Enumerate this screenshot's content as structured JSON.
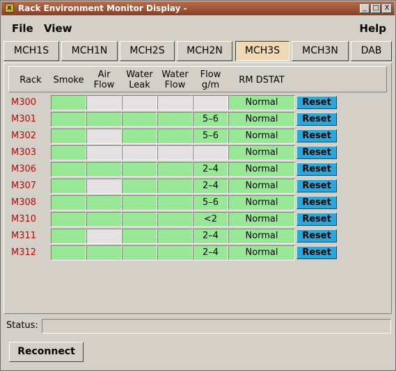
{
  "window": {
    "title": "Rack Environment Monitor Display -",
    "controls": [
      "_",
      "□",
      "X"
    ]
  },
  "menu": {
    "file": "File",
    "view": "View",
    "help": "Help"
  },
  "tabs": [
    "MCH1S",
    "MCH1N",
    "MCH2S",
    "MCH2N",
    "MCH3S",
    "MCH3N",
    "DAB"
  ],
  "active_tab": "MCH3S",
  "columns": {
    "rack": "Rack",
    "smoke": "Smoke",
    "air_flow": [
      "Air",
      "Flow"
    ],
    "water_leak": [
      "Water",
      "Leak"
    ],
    "water_flow": [
      "Water",
      "Flow"
    ],
    "flow_gm": [
      "Flow",
      "g/m"
    ],
    "rm_dstat": "RM DSTAT"
  },
  "colors": {
    "ok": "#98e898",
    "inactive": "#e6e2e4",
    "rack_label": "#d00000",
    "reset": "#29a8d9"
  },
  "rows": [
    {
      "rack": "M300",
      "smoke": "ok",
      "air_flow": "inactive",
      "water_leak": "inactive",
      "water_flow": "inactive",
      "flow_state": "inactive",
      "flow": "",
      "dstat": "Normal",
      "reset": "Reset"
    },
    {
      "rack": "M301",
      "smoke": "ok",
      "air_flow": "ok",
      "water_leak": "ok",
      "water_flow": "ok",
      "flow_state": "ok",
      "flow": "5–6",
      "dstat": "Normal",
      "reset": "Reset"
    },
    {
      "rack": "M302",
      "smoke": "ok",
      "air_flow": "inactive",
      "water_leak": "ok",
      "water_flow": "ok",
      "flow_state": "ok",
      "flow": "5–6",
      "dstat": "Normal",
      "reset": "Reset"
    },
    {
      "rack": "M303",
      "smoke": "ok",
      "air_flow": "inactive",
      "water_leak": "inactive",
      "water_flow": "inactive",
      "flow_state": "inactive",
      "flow": "",
      "dstat": "Normal",
      "reset": "Reset"
    },
    {
      "rack": "M306",
      "smoke": "ok",
      "air_flow": "ok",
      "water_leak": "ok",
      "water_flow": "ok",
      "flow_state": "ok",
      "flow": "2–4",
      "dstat": "Normal",
      "reset": "Reset"
    },
    {
      "rack": "M307",
      "smoke": "ok",
      "air_flow": "inactive",
      "water_leak": "ok",
      "water_flow": "ok",
      "flow_state": "ok",
      "flow": "2–4",
      "dstat": "Normal",
      "reset": "Reset"
    },
    {
      "rack": "M308",
      "smoke": "ok",
      "air_flow": "ok",
      "water_leak": "ok",
      "water_flow": "ok",
      "flow_state": "ok",
      "flow": "5–6",
      "dstat": "Normal",
      "reset": "Reset"
    },
    {
      "rack": "M310",
      "smoke": "ok",
      "air_flow": "ok",
      "water_leak": "ok",
      "water_flow": "ok",
      "flow_state": "ok",
      "flow": "<2",
      "dstat": "Normal",
      "reset": "Reset"
    },
    {
      "rack": "M311",
      "smoke": "ok",
      "air_flow": "inactive",
      "water_leak": "ok",
      "water_flow": "ok",
      "flow_state": "ok",
      "flow": "2–4",
      "dstat": "Normal",
      "reset": "Reset"
    },
    {
      "rack": "M312",
      "smoke": "ok",
      "air_flow": "ok",
      "water_leak": "ok",
      "water_flow": "ok",
      "flow_state": "ok",
      "flow": "2–4",
      "dstat": "Normal",
      "reset": "Reset"
    }
  ],
  "status": {
    "label": "Status:",
    "value": ""
  },
  "reconnect_label": "Reconnect"
}
